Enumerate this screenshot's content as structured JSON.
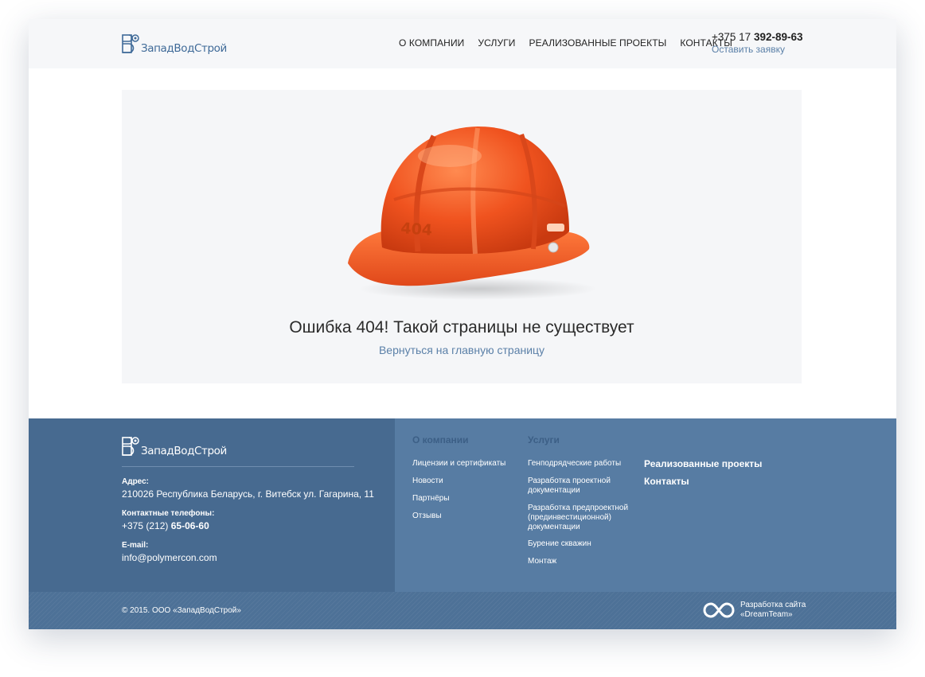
{
  "header": {
    "logo_text": "ЗападВодСтрой",
    "nav": [
      "О КОМПАНИИ",
      "УСЛУГИ",
      "РЕАЛИЗОВАННЫЕ ПРОЕКТЫ",
      "КОНТАКТЫ"
    ],
    "phone_prefix": "+375 17",
    "phone_number": "392-89-63",
    "request_label": "Оставить заявку"
  },
  "hero": {
    "helmet_label": "404",
    "title": "Ошибка 404! Такой страницы не существует",
    "link": "Вернуться на главную страницу"
  },
  "footer": {
    "logo_text": "ЗападВодСтрой",
    "address_label": "Адрес:",
    "address_value": "210026 Республика Беларусь, г. Витебск ул. Гагарина, 11",
    "phones_label": "Контактные телефоны:",
    "phones_prefix": "+375 (212)",
    "phones_number": "65-06-60",
    "email_label": "E-mail:",
    "email_value": "info@polymercon.com",
    "col1_title": "О компании",
    "col1_items": [
      "Лицензии и сертификаты",
      "Новости",
      "Партнёры",
      "Отзывы"
    ],
    "col2_title": "Услуги",
    "col2_items": [
      "Генподрядческие работы",
      "Разработка проектной документации",
      "Разработка предпроектной (прединвестиционной) документации",
      "Бурение скважин",
      "Монтаж"
    ],
    "col3_items": [
      "Реализованные проекты",
      "Контакты"
    ],
    "copyright": "© 2015. ООО «ЗападВодСтрой»",
    "dev_line1": "Разработка сайта",
    "dev_line2": "«DreamTeam»"
  },
  "colors": {
    "brand_blue": "#3f6a98",
    "footer_dark": "#476a90",
    "footer_light": "#577ca3",
    "helmet_orange": "#f0531f"
  }
}
